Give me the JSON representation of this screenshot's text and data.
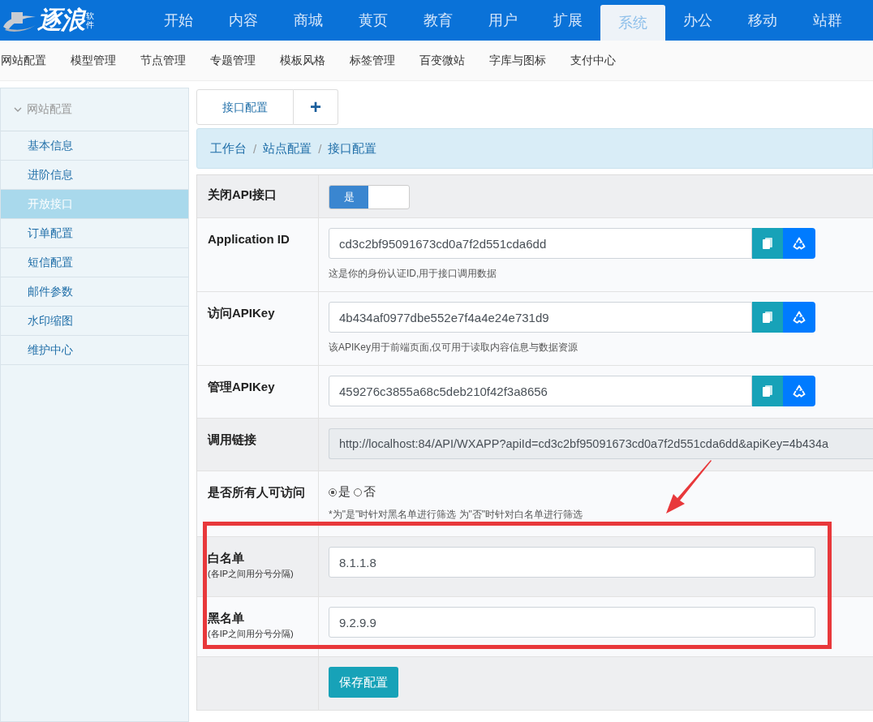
{
  "logo": {
    "text": "逐浪",
    "badge": "软件"
  },
  "nav": [
    {
      "label": "开始",
      "selected": false
    },
    {
      "label": "内容",
      "selected": false
    },
    {
      "label": "商城",
      "selected": false
    },
    {
      "label": "黄页",
      "selected": false
    },
    {
      "label": "教育",
      "selected": false
    },
    {
      "label": "用户",
      "selected": false
    },
    {
      "label": "扩展",
      "selected": false
    },
    {
      "label": "系统",
      "selected": true
    },
    {
      "label": "办公",
      "selected": false
    },
    {
      "label": "移动",
      "selected": false
    },
    {
      "label": "站群",
      "selected": false
    }
  ],
  "subnav": [
    "网站配置",
    "模型管理",
    "节点管理",
    "专题管理",
    "模板风格",
    "标签管理",
    "百变微站",
    "字库与图标",
    "支付中心"
  ],
  "sidebar": {
    "title": "网站配置",
    "expanded": true,
    "items": [
      {
        "label": "基本信息",
        "selected": false
      },
      {
        "label": "进阶信息",
        "selected": false
      },
      {
        "label": "开放接口",
        "selected": true
      },
      {
        "label": "订单配置",
        "selected": false
      },
      {
        "label": "短信配置",
        "selected": false
      },
      {
        "label": "邮件参数",
        "selected": false
      },
      {
        "label": "水印缩图",
        "selected": false
      },
      {
        "label": "维护中心",
        "selected": false
      }
    ]
  },
  "tabs": [
    {
      "label": "接口配置",
      "kind": "text"
    },
    {
      "label": "+",
      "kind": "add"
    }
  ],
  "breadcrumb": [
    {
      "kind": "link",
      "label": "工作台"
    },
    {
      "kind": "separator",
      "label": "/"
    },
    {
      "kind": "link",
      "label": "站点配置"
    },
    {
      "kind": "separator",
      "label": "/"
    },
    {
      "kind": "link",
      "label": "接口配置"
    }
  ],
  "form": {
    "rows": [
      {
        "kind": "switch",
        "label": "关闭API接口",
        "on": true,
        "on_text": "是"
      },
      {
        "kind": "key",
        "label": "Application ID",
        "value": "cd3c2bf95091673cd0a7f2d551cda6dd",
        "help": "这是你的身份认证ID,用于接口调用数据"
      },
      {
        "kind": "key",
        "label": "访问APIKey",
        "value": "4b434af0977dbe552e7f4a4e24e731d9",
        "help": "该APIKey用于前端页面,仅可用于读取内容信息与数据资源"
      },
      {
        "kind": "key",
        "label": "管理APIKey",
        "value": "459276c3855a68c5deb210f42f3a8656"
      },
      {
        "kind": "readonly",
        "label": "调用链接",
        "value": "http://localhost:84/API/WXAPP?apiId=cd3c2bf95091673cd0a7f2d551cda6dd&apiKey=4b434a"
      },
      {
        "kind": "radio",
        "label": "是否所有人可访问",
        "options": [
          {
            "label": "是",
            "selected": true
          },
          {
            "label": "否",
            "selected": false
          }
        ],
        "help": "*为\"是\"时针对黑名单进行筛选 为\"否\"时针对白名单进行筛选"
      },
      {
        "kind": "input",
        "label": "白名单",
        "note": "(各IP之间用分号分隔)",
        "value": "8.1.1.8"
      },
      {
        "kind": "input",
        "label": "黑名单",
        "note": "(各IP之间用分号分隔)",
        "value": "9.2.9.9"
      },
      {
        "kind": "submit",
        "label": "保存配置"
      }
    ]
  }
}
